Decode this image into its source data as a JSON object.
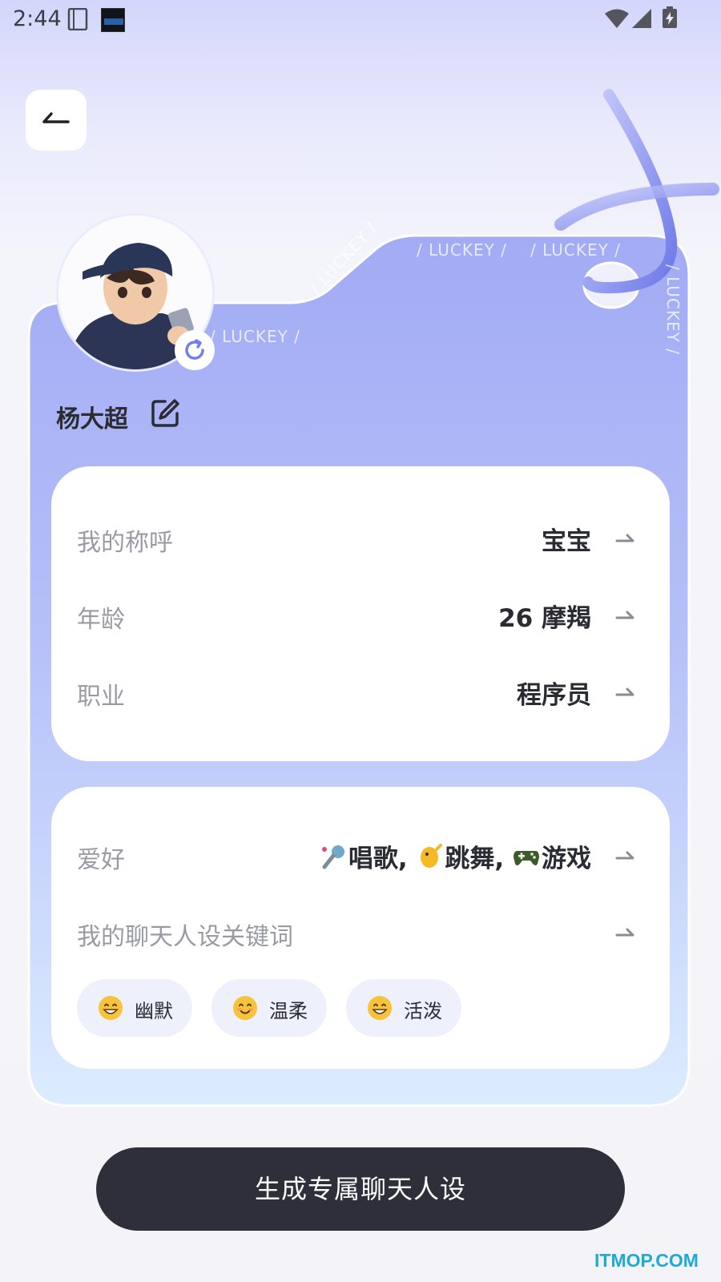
{
  "status_bar": {
    "time": "2:44"
  },
  "profile": {
    "name": "杨大超"
  },
  "card": {
    "watermark_word": "/ LUCKEY /"
  },
  "basic_info": [
    {
      "label": "我的称呼",
      "value": "宝宝"
    },
    {
      "label": "年龄",
      "value": "26 摩羯"
    },
    {
      "label": "职业",
      "value": "程序员"
    }
  ],
  "hobby": {
    "label": "爱好",
    "items": [
      "唱歌,",
      "跳舞,",
      "游戏"
    ]
  },
  "keywords": {
    "label": "我的聊天人设关键词",
    "tags": [
      "幽默",
      "温柔",
      "活泼"
    ]
  },
  "generate_button": "生成专属聊天人设",
  "watermark": "ITMOP.COM",
  "colors": {
    "card_top": "#a6b0f6",
    "card_bottom": "#dcecff",
    "button": "#2f2f3b",
    "accent": "#6f7ff0"
  }
}
